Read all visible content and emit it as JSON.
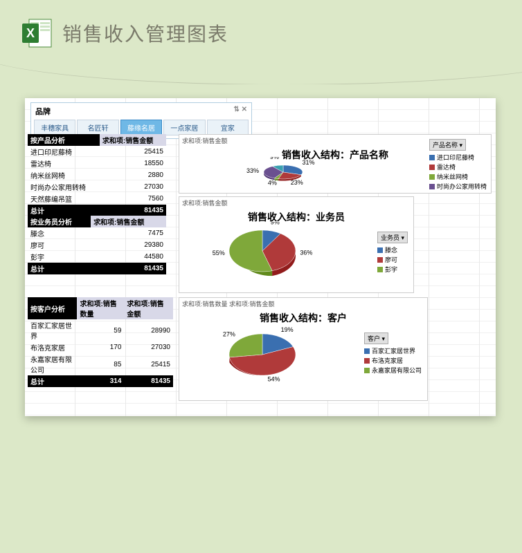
{
  "header": {
    "title": "销售收入管理图表"
  },
  "slicer": {
    "title": "品牌",
    "items": [
      {
        "label": "丰穗家具",
        "active": false
      },
      {
        "label": "名匠轩",
        "active": false
      },
      {
        "label": "藤缘名居",
        "active": true
      },
      {
        "label": "一点家居",
        "active": false
      },
      {
        "label": "宜家",
        "active": false
      }
    ]
  },
  "pivot_product": {
    "header": [
      "按产品分析",
      "求和项:销售金额"
    ],
    "rows": [
      {
        "name": "进口印尼藤椅",
        "value": 25415
      },
      {
        "name": "雷达椅",
        "value": 18550
      },
      {
        "name": "纳米丝网椅",
        "value": 2880
      },
      {
        "name": "时尚办公家用转椅",
        "value": 27030
      },
      {
        "name": "天然藤编吊篮",
        "value": 7560
      }
    ],
    "total": {
      "label": "总计",
      "value": 81435
    }
  },
  "pivot_sales": {
    "header": [
      "按业务员分析",
      "求和项:销售金额"
    ],
    "rows": [
      {
        "name": "滕念",
        "value": 7475
      },
      {
        "name": "廖可",
        "value": 29380
      },
      {
        "name": "彭宇",
        "value": 44580
      }
    ],
    "total": {
      "label": "总计",
      "value": 81435
    }
  },
  "pivot_customer": {
    "header": [
      "按客户分析",
      "求和项:销售数量",
      "求和项:销售金额"
    ],
    "rows": [
      {
        "name": "百家汇家居世界",
        "qty": 59,
        "value": 28990
      },
      {
        "name": "布洛克家居",
        "qty": 170,
        "value": 27030
      },
      {
        "name": "永嘉家居有限公司",
        "qty": 85,
        "value": 25415
      }
    ],
    "total": {
      "label": "总计",
      "qty": 314,
      "value": 81435
    }
  },
  "chart_data": [
    {
      "id": "product_pie",
      "type": "pie",
      "title": "销售收入结构：产品名称",
      "field_label": "求和项:销售金额",
      "legend_title": "产品名称",
      "series": [
        {
          "name": "进口印尼藤椅",
          "value": 25415,
          "pct": 31,
          "color": "#3a6fb0"
        },
        {
          "name": "雷达椅",
          "value": 18550,
          "pct": 23,
          "color": "#b03a3a"
        },
        {
          "name": "纳米丝网椅",
          "value": 2880,
          "pct": 4,
          "color": "#7fa83a"
        },
        {
          "name": "时尚办公家用转椅",
          "value": 27030,
          "pct": 33,
          "color": "#6a5090"
        },
        {
          "name": "天然藤编吊篮",
          "value": 7560,
          "pct": 9,
          "color": "#3aa0b0"
        }
      ]
    },
    {
      "id": "sales_pie",
      "type": "pie",
      "title": "销售收入结构：业务员",
      "field_label": "求和项:销售金额",
      "legend_title": "业务员",
      "series": [
        {
          "name": "滕念",
          "value": 7475,
          "pct": 9,
          "color": "#3a6fb0"
        },
        {
          "name": "廖可",
          "value": 29380,
          "pct": 36,
          "color": "#b03a3a"
        },
        {
          "name": "彭宇",
          "value": 44580,
          "pct": 55,
          "color": "#7fa83a"
        }
      ]
    },
    {
      "id": "customer_pie",
      "type": "pie",
      "title": "销售收入结构：客户",
      "field_label": "求和项:销售数量 求和项:销售金额",
      "legend_title": "客户",
      "series": [
        {
          "name": "百家汇家居世界",
          "value": 59,
          "pct": 19,
          "color": "#3a6fb0"
        },
        {
          "name": "布洛克家居",
          "value": 170,
          "pct": 54,
          "color": "#b03a3a"
        },
        {
          "name": "永嘉家居有限公司",
          "value": 85,
          "pct": 27,
          "color": "#7fa83a"
        }
      ]
    }
  ],
  "colors": {
    "blue": "#3a6fb0",
    "red": "#b03a3a",
    "green": "#7fa83a",
    "purple": "#6a5090"
  }
}
